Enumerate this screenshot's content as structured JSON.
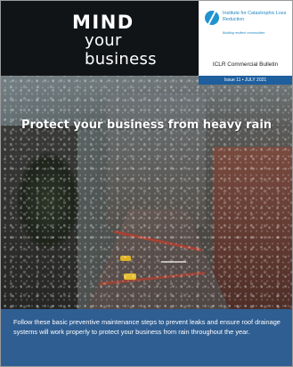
{
  "header": {
    "title_line1": "MIND",
    "title_line2": "your business",
    "org_name": "Institute for Catastrophic Loss Reduction",
    "org_tagline": "Building resilient communities",
    "bulletin_title": "ICLR Commercial Bulletin",
    "issue": "Issue 11 • JULY 2021"
  },
  "icons": {
    "logo": "iclr-logo-icon"
  },
  "main": {
    "headline": "Protect your business from heavy rain",
    "caption": "Follow these basic preventive maintenance steps to prevent leaks and ensure roof drainage systems will work properly to protect your business from rain throughout the year."
  },
  "colors": {
    "header_dark": "#111417",
    "brand_blue": "#1f86c1",
    "issue_bar": "#1f5f9e",
    "caption_band": "#2f5e92"
  }
}
